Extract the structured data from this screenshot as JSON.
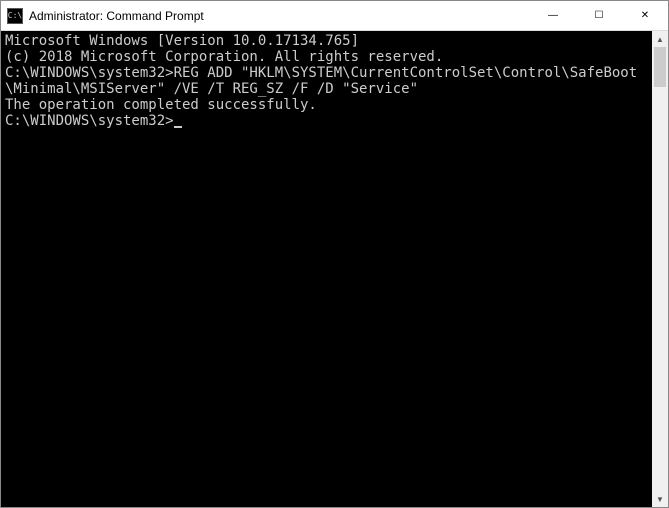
{
  "titlebar": {
    "icon_label": "C:\\",
    "title": "Administrator: Command Prompt"
  },
  "controls": {
    "minimize": "—",
    "maximize": "☐",
    "close": "✕"
  },
  "terminal": {
    "line1": "Microsoft Windows [Version 10.0.17134.765]",
    "line2": "(c) 2018 Microsoft Corporation. All rights reserved.",
    "blank1": "",
    "line3": "C:\\WINDOWS\\system32>REG ADD \"HKLM\\SYSTEM\\CurrentControlSet\\Control\\SafeBoot\\Minimal\\MSIServer\" /VE /T REG_SZ /F /D \"Service\"",
    "line4": "The operation completed successfully.",
    "blank2": "",
    "prompt": "C:\\WINDOWS\\system32>"
  },
  "scrollbar": {
    "up": "▲",
    "down": "▼"
  }
}
